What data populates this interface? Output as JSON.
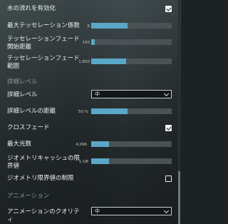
{
  "settings": {
    "water_flow": {
      "label": "水の流れを有効化",
      "checked": true
    },
    "max_tessellation": {
      "label": "最大テッセレーション係数",
      "value": "6",
      "fraction": 0.45
    },
    "tess_fade_start": {
      "label": "テッセレーションフェード開始距離",
      "value": "150",
      "fraction": 0.04
    },
    "tess_fade_range": {
      "label": "テッセレーションフェード範囲",
      "value": "1,850",
      "fraction": 0.43
    }
  },
  "detail_section": {
    "title": "詳細レベル"
  },
  "detail": {
    "level": {
      "label": "詳細レベル",
      "selected": "中"
    },
    "distance": {
      "label": "詳細レベルの距離",
      "value": "50 %",
      "fraction": 0.45
    },
    "crossfade": {
      "label": "クロスフェード",
      "checked": true
    },
    "max_lights": {
      "label": "最大光数",
      "value": "4,096",
      "fraction": 0.22
    },
    "geometry_cache": {
      "label": "ジオメトリキャッシュの限界値",
      "value": "1 GB",
      "fraction": 0.22
    },
    "geometry_limit": {
      "label": "ジオメトリ限界値の制限",
      "checked": false
    }
  },
  "animation_section": {
    "title": "アニメーション"
  },
  "animation": {
    "quality": {
      "label": "アニメーションのクオリティ",
      "selected": "中"
    }
  }
}
